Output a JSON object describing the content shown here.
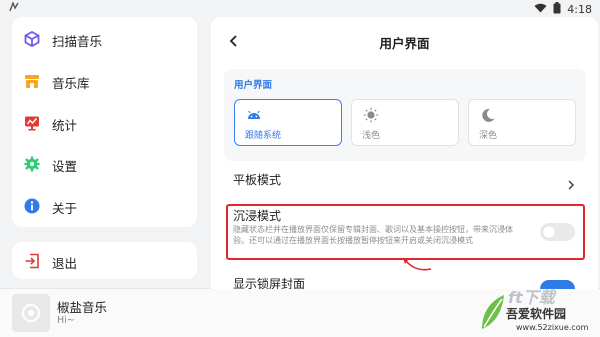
{
  "status": {
    "left_icon": "app-notification-icon",
    "time": "4:18"
  },
  "sidebar": {
    "items": [
      {
        "label": "扫描音乐",
        "icon": "scan-cube-icon",
        "color": "#6c5ce7"
      },
      {
        "label": "音乐库",
        "icon": "library-store-icon",
        "color": "#f5a623"
      },
      {
        "label": "统计",
        "icon": "stats-chart-icon",
        "color": "#e53935"
      },
      {
        "label": "设置",
        "icon": "gear-icon",
        "color": "#2ecc71"
      },
      {
        "label": "关于",
        "icon": "info-icon",
        "color": "#2f7be8"
      }
    ],
    "exit_label": "退出"
  },
  "player": {
    "title": "椒盐音乐",
    "subtitle": "Hi~"
  },
  "panel": {
    "title": "用户界面",
    "section_label": "用户界面",
    "themes": [
      {
        "label": "跟随系统",
        "icon": "android-icon",
        "selected": true
      },
      {
        "label": "浅色",
        "icon": "sun-icon",
        "selected": false
      },
      {
        "label": "深色",
        "icon": "moon-icon",
        "selected": false
      }
    ],
    "tablet_mode_label": "平板模式",
    "immersive": {
      "title": "沉浸模式",
      "description": "隐藏状态栏并在播放界面仅保留专辑封面、歌词以及基本操控按钮，带来沉浸体验。还可以通过在播放界面长按播放暂停按钮来开启或关闭沉浸模式",
      "enabled": false
    },
    "lockscreen_cover_label": "显示锁屏封面",
    "lockscreen_cover_enabled": true
  },
  "watermark": {
    "line1": "ft下载",
    "line2": "吾爱软件园",
    "line3": "www.52zixue.com"
  },
  "colors": {
    "accent": "#2f7be8",
    "highlight": "#e3262c"
  }
}
